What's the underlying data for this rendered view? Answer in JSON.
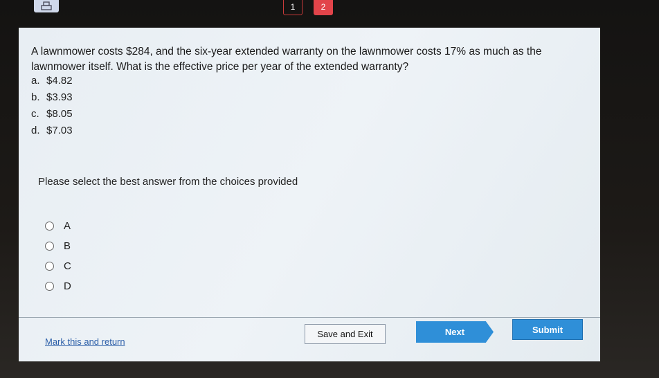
{
  "topbar": {
    "print_icon": "printer-icon",
    "pages": [
      "1",
      "2"
    ],
    "active_page": "2"
  },
  "question": {
    "text": "A lawnmower costs $284, and the six-year extended warranty on the lawnmower costs 17% as much as the lawnmower itself. What is the effective price per year of the extended warranty?",
    "choices": [
      {
        "letter": "a.",
        "value": "$4.82"
      },
      {
        "letter": "b.",
        "value": "$3.93"
      },
      {
        "letter": "c.",
        "value": "$8.05"
      },
      {
        "letter": "d.",
        "value": "$7.03"
      }
    ]
  },
  "prompt": "Please select the best answer from the choices provided",
  "options": [
    "A",
    "B",
    "C",
    "D"
  ],
  "footer": {
    "mark_link": "Mark this and return",
    "save_label": "Save and Exit",
    "next_label": "Next",
    "submit_label": "Submit"
  },
  "colors": {
    "accent": "#2f8fd8",
    "page_active": "#e2444a",
    "link": "#2b5ea8"
  }
}
